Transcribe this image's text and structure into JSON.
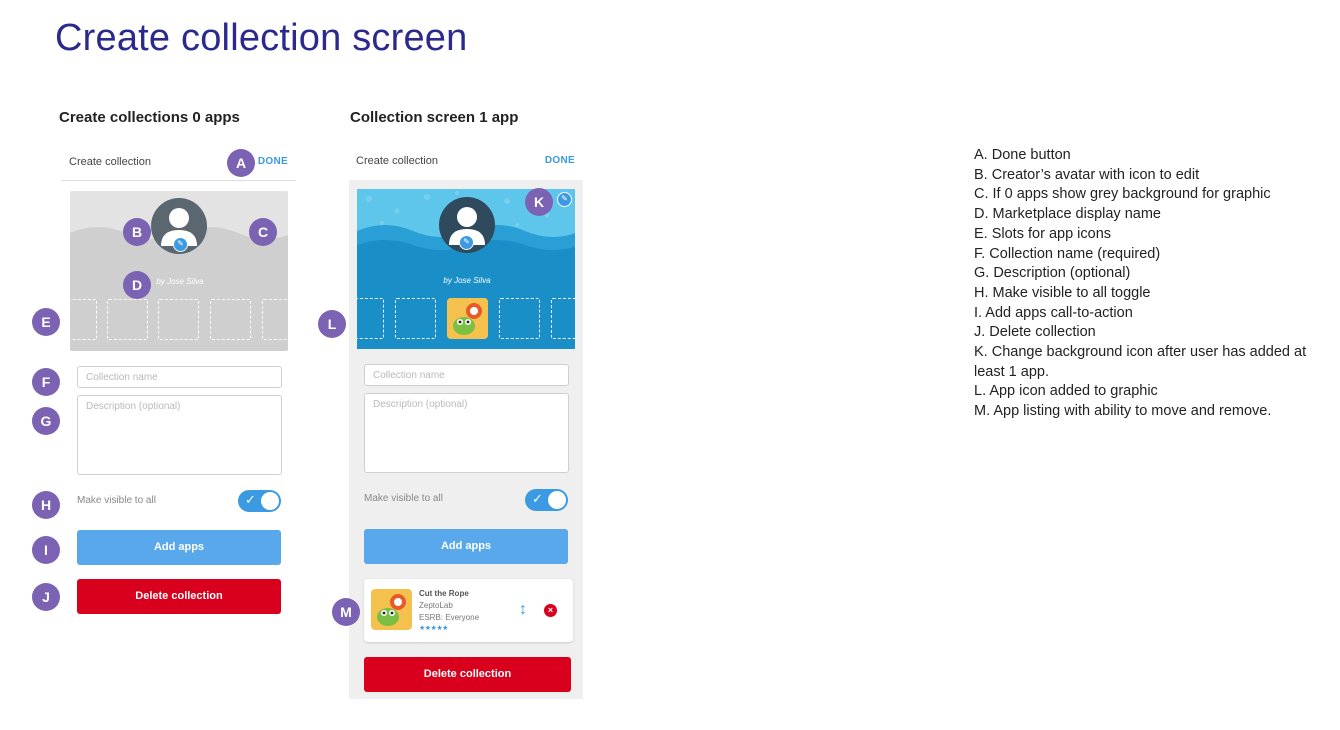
{
  "page_title": "Create collection screen",
  "left": {
    "heading": "Create collections 0 apps",
    "header_label": "Create collection",
    "done_label": "DONE",
    "byline": "by Jose Silva",
    "name_placeholder": "Collection name",
    "description_placeholder": "Description (optional)",
    "toggle_label": "Make visible to all",
    "toggle_on": true,
    "add_apps_label": "Add apps",
    "delete_label": "Delete collection",
    "badges": [
      "A",
      "B",
      "C",
      "D",
      "E",
      "F",
      "G",
      "H",
      "I",
      "J"
    ]
  },
  "right": {
    "heading": "Collection screen 1 app",
    "header_label": "Create collection",
    "done_label": "DONE",
    "byline": "by Jose Silva",
    "name_placeholder": "Collection name",
    "description_placeholder": "Description (optional)",
    "toggle_label": "Make visible to all",
    "toggle_on": true,
    "add_apps_label": "Add apps",
    "delete_label": "Delete collection",
    "badges": [
      "K",
      "L",
      "M"
    ],
    "app": {
      "name": "Cut the Rope",
      "developer": "ZeptoLab",
      "rating": "ESRB: Everyone",
      "stars": "★★★★★",
      "move_icon": "move-vertical-icon",
      "remove_icon": "remove-icon"
    }
  },
  "legend": [
    "A. Done button",
    "B. Creator’s avatar with icon to edit",
    "C. If 0 apps show grey background for graphic",
    "D. Marketplace display name",
    "E. Slots for app icons",
    "F. Collection name (required)",
    "G. Description (optional)",
    "H. Make visible to all toggle",
    "I. Add apps call-to-action",
    "J. Delete collection",
    "K. Change background icon after user has added at least 1 app.",
    "L. App icon added to graphic",
    "M. App listing with ability to move and remove."
  ],
  "colors": {
    "title": "#2b2a8c",
    "accent": "#3b9ae1",
    "danger": "#d8001c",
    "badge": "#7b62b3",
    "grey_hero": "#d9d9d9",
    "blue_hero": "#2a9fd6"
  }
}
